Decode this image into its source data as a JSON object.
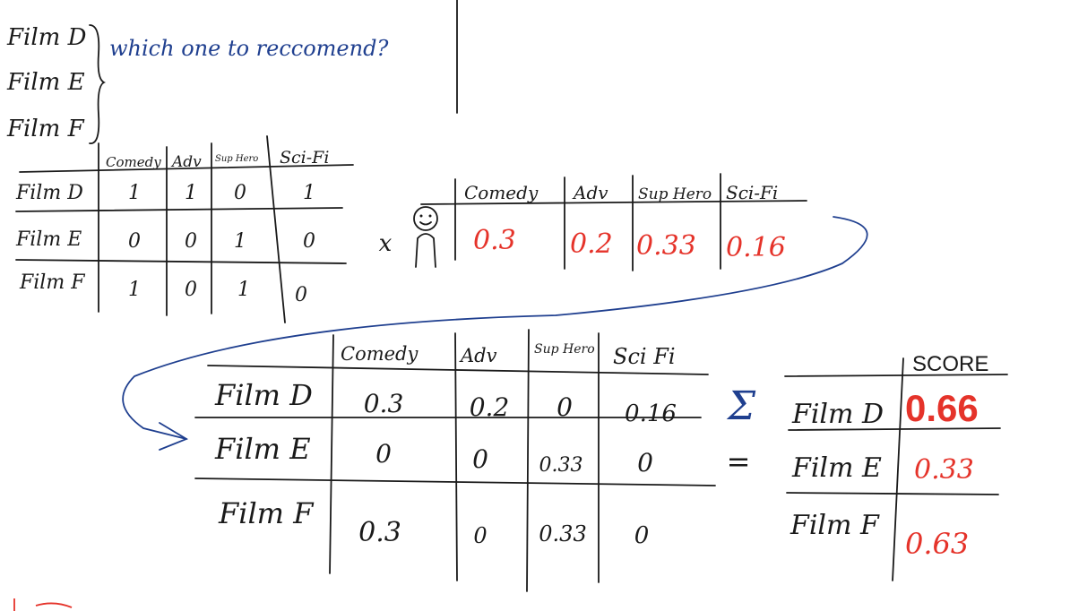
{
  "question": {
    "films": [
      "Film D",
      "Film E",
      "Film F"
    ],
    "prompt": "which one to reccomend?"
  },
  "film_genre_table": {
    "headers": [
      "Comedy",
      "Adv",
      "Sup Hero",
      "Sci-Fi"
    ],
    "rows": [
      {
        "label": "Film D",
        "values": [
          "1",
          "1",
          "0",
          "1"
        ]
      },
      {
        "label": "Film E",
        "values": [
          "0",
          "0",
          "1",
          "0"
        ]
      },
      {
        "label": "Film F",
        "values": [
          "1",
          "0",
          "1",
          "0"
        ]
      }
    ]
  },
  "operator_multiply": "x",
  "user_profile": {
    "headers": [
      "Comedy",
      "Adv",
      "Sup Hero",
      "Sci-Fi"
    ],
    "values": [
      "0.3",
      "0.2",
      "0.33",
      "0.16"
    ]
  },
  "weighted_table": {
    "headers": [
      "Comedy",
      "Adv",
      "Sup Hero",
      "Sci Fi"
    ],
    "rows": [
      {
        "label": "Film D",
        "values": [
          "0.3",
          "0.2",
          "0",
          "0.16"
        ]
      },
      {
        "label": "Film E",
        "values": [
          "0",
          "0",
          "0.33",
          "0"
        ]
      },
      {
        "label": "Film F",
        "values": [
          "0.3",
          "0",
          "0.33",
          "0"
        ]
      }
    ]
  },
  "operator_sum": "Σ",
  "operator_equals": "=",
  "score_table": {
    "header": "SCORE",
    "rows": [
      {
        "label": "Film D",
        "value": "0.66"
      },
      {
        "label": "Film E",
        "value": "0.33"
      },
      {
        "label": "Film F",
        "value": "0.63"
      }
    ]
  },
  "colors": {
    "ink": "#1a1a1a",
    "blue": "#1f3f8f",
    "red": "#e5332a"
  }
}
